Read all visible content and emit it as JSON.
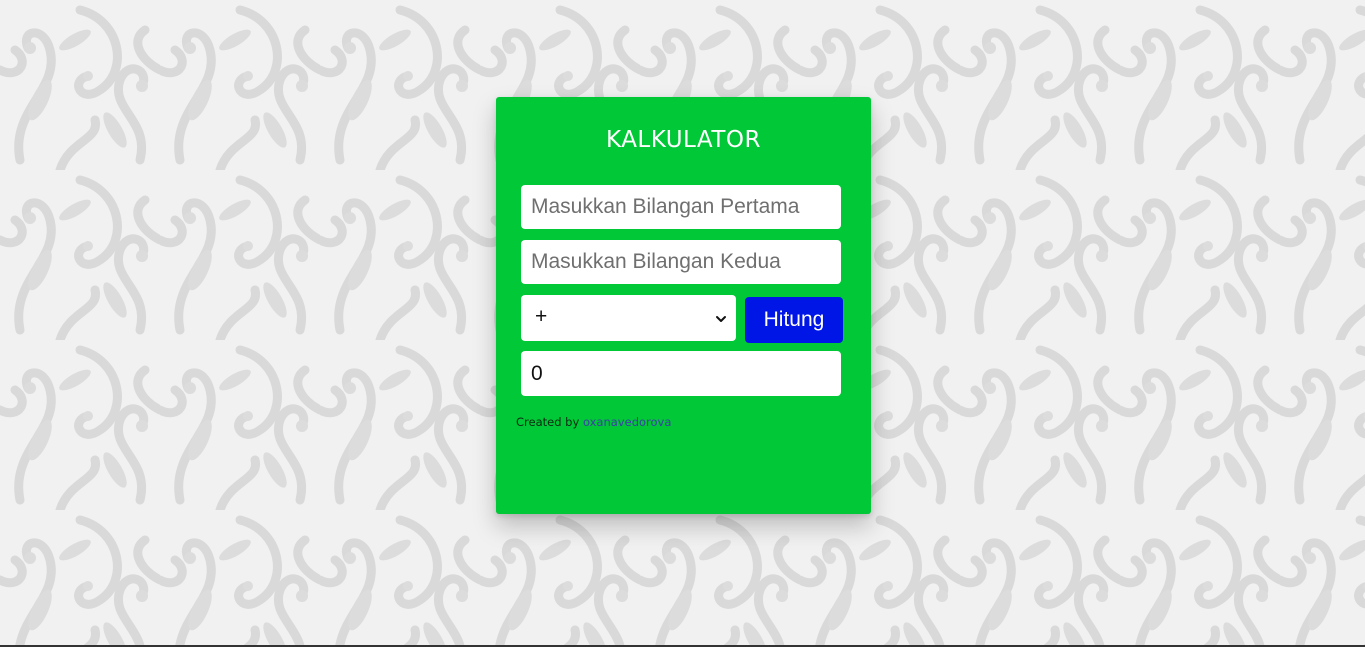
{
  "calculator": {
    "title": "KALKULATOR",
    "first_input": {
      "placeholder": "Masukkan Bilangan Pertama",
      "value": ""
    },
    "second_input": {
      "placeholder": "Masukkan Bilangan Kedua",
      "value": ""
    },
    "operator_select": {
      "selected": "+"
    },
    "calculate_button": "Hitung",
    "result_value": "0",
    "credit_prefix": "Created by",
    "credit_author": "oxanavedorova"
  },
  "colors": {
    "card_background": "#00c837",
    "button_background": "#0016e6",
    "page_background": "#f1f1f1",
    "pattern": "#d8d8d8",
    "credit_link": "#3b3fa6"
  },
  "icons": {
    "select_arrow": "chevron-down-icon"
  }
}
